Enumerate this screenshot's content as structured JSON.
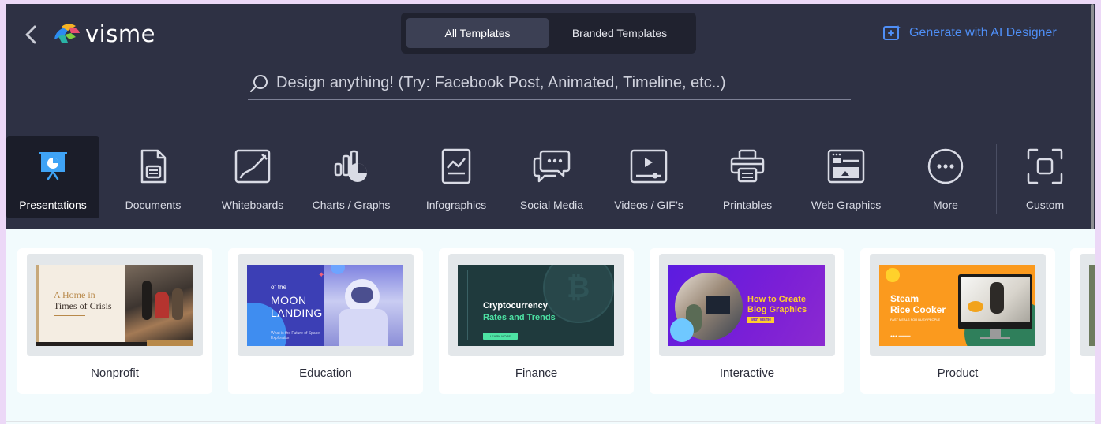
{
  "brand": {
    "name": "visme"
  },
  "tabs": [
    {
      "label": "All Templates",
      "active": true
    },
    {
      "label": "Branded Templates",
      "active": false
    }
  ],
  "ai_button": {
    "label": "Generate with AI Designer",
    "color": "#4f8ff7"
  },
  "search": {
    "placeholder": "Design anything! (Try: Facebook Post, Animated, Timeline, etc..)"
  },
  "categories": [
    {
      "label": "Presentations",
      "icon": "presentation-icon",
      "active": true
    },
    {
      "label": "Documents",
      "icon": "document-icon"
    },
    {
      "label": "Whiteboards",
      "icon": "whiteboard-icon"
    },
    {
      "label": "Charts / Graphs",
      "icon": "chart-icon"
    },
    {
      "label": "Infographics",
      "icon": "infographic-icon"
    },
    {
      "label": "Social Media",
      "icon": "chat-bubble-icon"
    },
    {
      "label": "Videos / GIF’s",
      "icon": "video-icon"
    },
    {
      "label": "Printables",
      "icon": "printer-icon"
    },
    {
      "label": "Web Graphics",
      "icon": "web-graphic-icon"
    },
    {
      "label": "More",
      "icon": "more-icon"
    },
    {
      "label": "Custom",
      "icon": "custom-size-icon"
    }
  ],
  "templates": [
    {
      "label": "Nonprofit",
      "slide_title_1": "A Home in",
      "slide_title_2": "Times of Crisis"
    },
    {
      "label": "Education",
      "slide_small": "of the",
      "slide_title_1": "MOON",
      "slide_title_2": "LANDING",
      "slide_caption": "What is the Future of Space Exploration"
    },
    {
      "label": "Finance",
      "slide_title_1": "Cryptocurrency",
      "slide_title_2": "Rates and Trends",
      "slide_button": "LEARN MORE"
    },
    {
      "label": "Interactive",
      "slide_title_1": "How to Create",
      "slide_title_2": "Blog Graphics",
      "slide_tag": "with Visme"
    },
    {
      "label": "Product",
      "slide_title_1": "Steam",
      "slide_title_2": "Rice Cooker",
      "slide_caption": "FAST MEALS FOR BUSY PEOPLE"
    }
  ],
  "colors": {
    "header_bg": "#2e3144",
    "content_bg": "#f2fbfd",
    "accent": "#4f8ff7"
  }
}
